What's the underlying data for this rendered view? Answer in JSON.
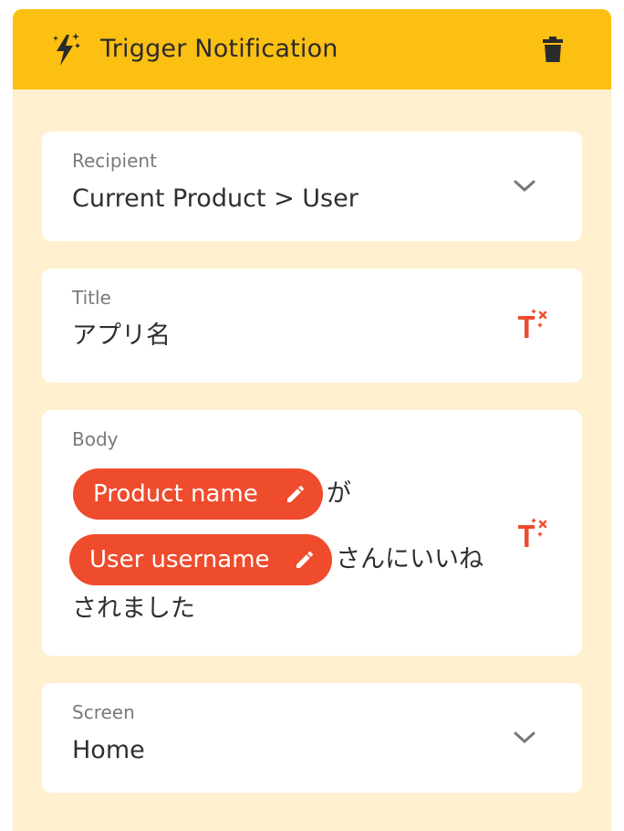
{
  "header": {
    "title": "Trigger Notification",
    "icon": "magic-lightning-icon",
    "delete_icon": "trash-icon",
    "color": "#fcc013"
  },
  "panel_bg": "#fff1cf",
  "recipient": {
    "label": "Recipient",
    "value": "Current Product > User"
  },
  "title_field": {
    "label": "Title",
    "value": "アプリ名"
  },
  "body": {
    "label": "Body",
    "chip_product": "Product name",
    "text_ga": "が",
    "chip_user": "User username",
    "text_line2": "さんにいいね",
    "text_line3": "されました",
    "chip_color": "#ef4b2d"
  },
  "screen": {
    "label": "Screen",
    "value": "Home"
  }
}
